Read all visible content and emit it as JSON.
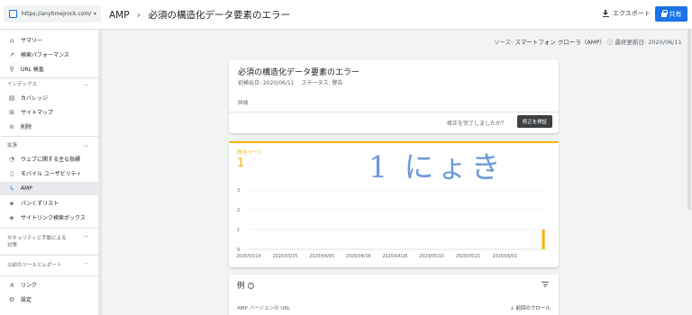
{
  "property": {
    "url": "https://anytimejrock.com/",
    "dropdown": "▾"
  },
  "header": {
    "breadcrumb_root": "AMP",
    "breadcrumb_sep": "›",
    "breadcrumb_page": "必須の構造化データ要素のエラー",
    "export_label": "エクスポート",
    "share_label": "共有"
  },
  "sidebar": {
    "top_items": [
      {
        "label": "サマリー",
        "icon": "home-icon"
      },
      {
        "label": "検索パフォーマンス",
        "icon": "trending-icon"
      },
      {
        "label": "URL 検査",
        "icon": "search-icon"
      }
    ],
    "index_section": "インデックス",
    "index_items": [
      {
        "label": "カバレッジ",
        "icon": "coverage-icon"
      },
      {
        "label": "サイトマップ",
        "icon": "sitemap-icon"
      },
      {
        "label": "削除",
        "icon": "remove-icon"
      }
    ],
    "ext_section": "拡張",
    "ext_items": [
      {
        "label": "ウェブに関する主な指標",
        "icon": "vitals-icon"
      },
      {
        "label": "モバイル ユーザビリティ",
        "icon": "mobile-icon"
      },
      {
        "label": "AMP",
        "icon": "amp-icon"
      },
      {
        "label": "パンくずリスト",
        "icon": "breadcrumb-icon"
      },
      {
        "label": "サイトリンク検索ボックス",
        "icon": "sitelinks-icon"
      }
    ],
    "security_section_line1": "セキュリティと手動による",
    "security_section_line2": "対策",
    "legacy_section": "以前のツールとレポート",
    "bottom_items": [
      {
        "label": "リンク",
        "icon": "links-icon"
      },
      {
        "label": "設定",
        "icon": "settings-icon"
      }
    ]
  },
  "source_bar": {
    "source_label": "ソース:",
    "source_value": "スマートフォン クローラ（AMP）",
    "updated_label": "最終更新日:",
    "updated_value": "2020/06/11"
  },
  "issue": {
    "title": "必須の構造化データ要素のエラー",
    "first_detected": "初検出日: 2020/06/11",
    "status": "ステータス: 警告",
    "details": "詳細",
    "fix_question": "修正を完了しましたか？",
    "validate_button": "修正を検証"
  },
  "affected": {
    "label": "該当ページ",
    "value": "1",
    "handwriting": "1 にょき"
  },
  "chart_data": {
    "type": "bar",
    "x": [
      "2020/03/14",
      "2020/03/25",
      "2020/04/05",
      "2020/04/16",
      "2020/04/28",
      "2020/05/10",
      "2020/05/21",
      "2020/06/01",
      "2020/06/11"
    ],
    "x_tick_labels": [
      "2020/03/14",
      "2020/03/25",
      "2020/04/05",
      "2020/04/16",
      "2020/04/28",
      "2020/05/10",
      "2020/05/21",
      "2020/06/01"
    ],
    "values": [
      0,
      0,
      0,
      0,
      0,
      0,
      0,
      0,
      1
    ],
    "y_ticks": [
      "3",
      "2",
      "1",
      "0"
    ],
    "ylim": [
      0,
      3
    ],
    "bar_color": "#f4b400",
    "grid": true
  },
  "examples": {
    "title": "例",
    "column_url": "AMP バージョンの URL",
    "column_crawl": "前回のクロール"
  }
}
